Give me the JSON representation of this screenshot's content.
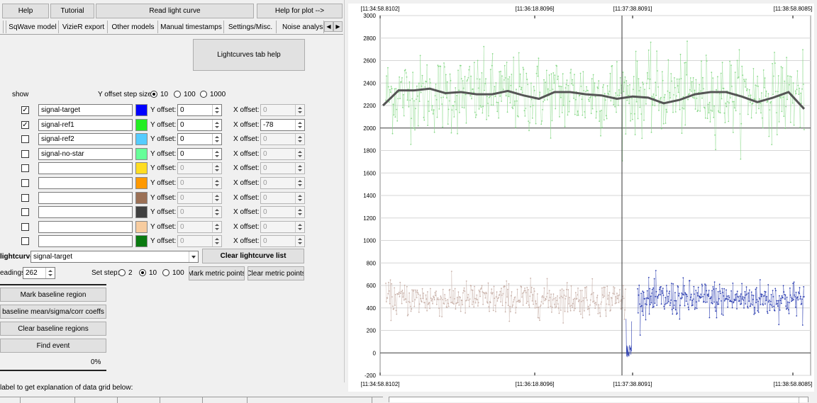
{
  "toolbar": {
    "help": "Help",
    "tutorial": "Tutorial",
    "read": "Read light curve",
    "help_plot": "Help for plot -->"
  },
  "tabs": [
    "SqWave model",
    "VizieR export",
    "Other models",
    "Manual timestamps",
    "Settings/Misc.",
    "Noise analysis/I"
  ],
  "tab_scroll_right": "▶",
  "lc_help_button": "Lightcurves tab help",
  "show_label": "show",
  "y_offset_step": {
    "label": "Y offset step size:",
    "options": [
      "10",
      "100",
      "1000"
    ],
    "selected": "10"
  },
  "rows": [
    {
      "checked": true,
      "name": "signal-target",
      "color": "#0000ff",
      "y_label": "Y offset:",
      "y": "0",
      "x_label": "X offset:",
      "x": "0",
      "y_enabled": true,
      "x_enabled": false
    },
    {
      "checked": true,
      "name": "signal-ref1",
      "color": "#22ee22",
      "y_label": "Y offset:",
      "y": "0",
      "x_label": "X offset:",
      "x": "-78",
      "y_enabled": true,
      "x_enabled": true
    },
    {
      "checked": false,
      "name": "signal-ref2",
      "color": "#55ccff",
      "y_label": "Y offset:",
      "y": "0",
      "x_label": "X offset:",
      "x": "0",
      "y_enabled": true,
      "x_enabled": false
    },
    {
      "checked": false,
      "name": "signal-no-star",
      "color": "#66ff99",
      "y_label": "Y offset:",
      "y": "0",
      "x_label": "X offset:",
      "x": "0",
      "y_enabled": true,
      "x_enabled": false
    },
    {
      "checked": false,
      "name": "",
      "color": "#ffdd22",
      "y_label": "Y offset:",
      "y": "0",
      "x_label": "X offset:",
      "x": "0",
      "y_enabled": false,
      "x_enabled": false
    },
    {
      "checked": false,
      "name": "",
      "color": "#ff9900",
      "y_label": "Y offset:",
      "y": "0",
      "x_label": "X offset:",
      "x": "0",
      "y_enabled": false,
      "x_enabled": false
    },
    {
      "checked": false,
      "name": "",
      "color": "#9b7055",
      "y_label": "Y offset:",
      "y": "0",
      "x_label": "X offset:",
      "x": "0",
      "y_enabled": false,
      "x_enabled": false
    },
    {
      "checked": false,
      "name": "",
      "color": "#404040",
      "y_label": "Y offset:",
      "y": "0",
      "x_label": "X offset:",
      "x": "0",
      "y_enabled": false,
      "x_enabled": false
    },
    {
      "checked": false,
      "name": "",
      "color": "#f7cc9f",
      "y_label": "Y offset:",
      "y": "0",
      "x_label": "X offset:",
      "x": "0",
      "y_enabled": false,
      "x_enabled": false
    },
    {
      "checked": false,
      "name": "",
      "color": "#0a7a10",
      "y_label": "Y offset:",
      "y": "0",
      "x_label": "X offset:",
      "x": "0",
      "y_enabled": false,
      "x_enabled": false
    }
  ],
  "lightcurve": {
    "label": "lightcurve",
    "selected": "signal-target",
    "clear_button": "Clear lightcurve list"
  },
  "readings": {
    "label": "eadings",
    "value": "262"
  },
  "set_step": {
    "label": "Set step:",
    "options": [
      "2",
      "10",
      "100"
    ],
    "selected": "10"
  },
  "mark_metric": "Mark metric points",
  "clear_metric": "Clear metric points",
  "left_buttons": [
    "Mark baseline region",
    "baseline mean/sigma/corr coeffs",
    "Clear baseline regions",
    "Find event"
  ],
  "progress": "0%",
  "bottom_text": "label to get explanation of data grid below:",
  "plot": {
    "top_ticks": [
      "[11:34:58.8102]",
      "[11:36:18.8096]",
      "[11:37:38.8091]",
      "[11:38:58.8085]"
    ],
    "bottom_ticks": [
      "[11:34:58.8102]",
      "[11:36:18.8096]",
      "[11:37:38.8091]",
      "[11:38:58.8085]"
    ]
  },
  "chart_data": {
    "type": "scatter",
    "y_ticks": [
      "3000",
      "2800",
      "2600",
      "2400",
      "2200",
      "2000",
      "1800",
      "1600",
      "1400",
      "1200",
      "1000",
      "800",
      "600",
      "400",
      "200",
      "0",
      "-200"
    ],
    "ylim": [
      -200,
      3000
    ],
    "x_tick_labels": [
      "[11:34:58.8102]",
      "[11:36:18.8096]",
      "[11:37:38.8091]",
      "[11:38:58.8085]"
    ],
    "grid": true,
    "reference_lines_y": [
      2000,
      0
    ],
    "series": [
      {
        "color": "#88d888",
        "band_mean": 2300,
        "band_sigma": 170,
        "range_fraction": [
          0,
          0.985
        ]
      },
      {
        "color": "#555555",
        "values": [
          2200,
          2335,
          2335,
          2350,
          2310,
          2320,
          2300,
          2300,
          2330,
          2290,
          2260,
          2320,
          2320,
          2300,
          2290,
          2260,
          2280,
          2270,
          2220,
          2250,
          2300,
          2320,
          2320,
          2280,
          2230,
          2270,
          2320,
          2170
        ]
      },
      {
        "color": "#c8b0a8",
        "band_mean": 480,
        "band_sigma": 75,
        "range_fraction": [
          0,
          0.57
        ]
      },
      {
        "color": "#2a3cb0",
        "band_mean": 480,
        "band_sigma": 80,
        "range_fraction": [
          0.585,
          0.985
        ],
        "event_min": -50
      }
    ]
  }
}
